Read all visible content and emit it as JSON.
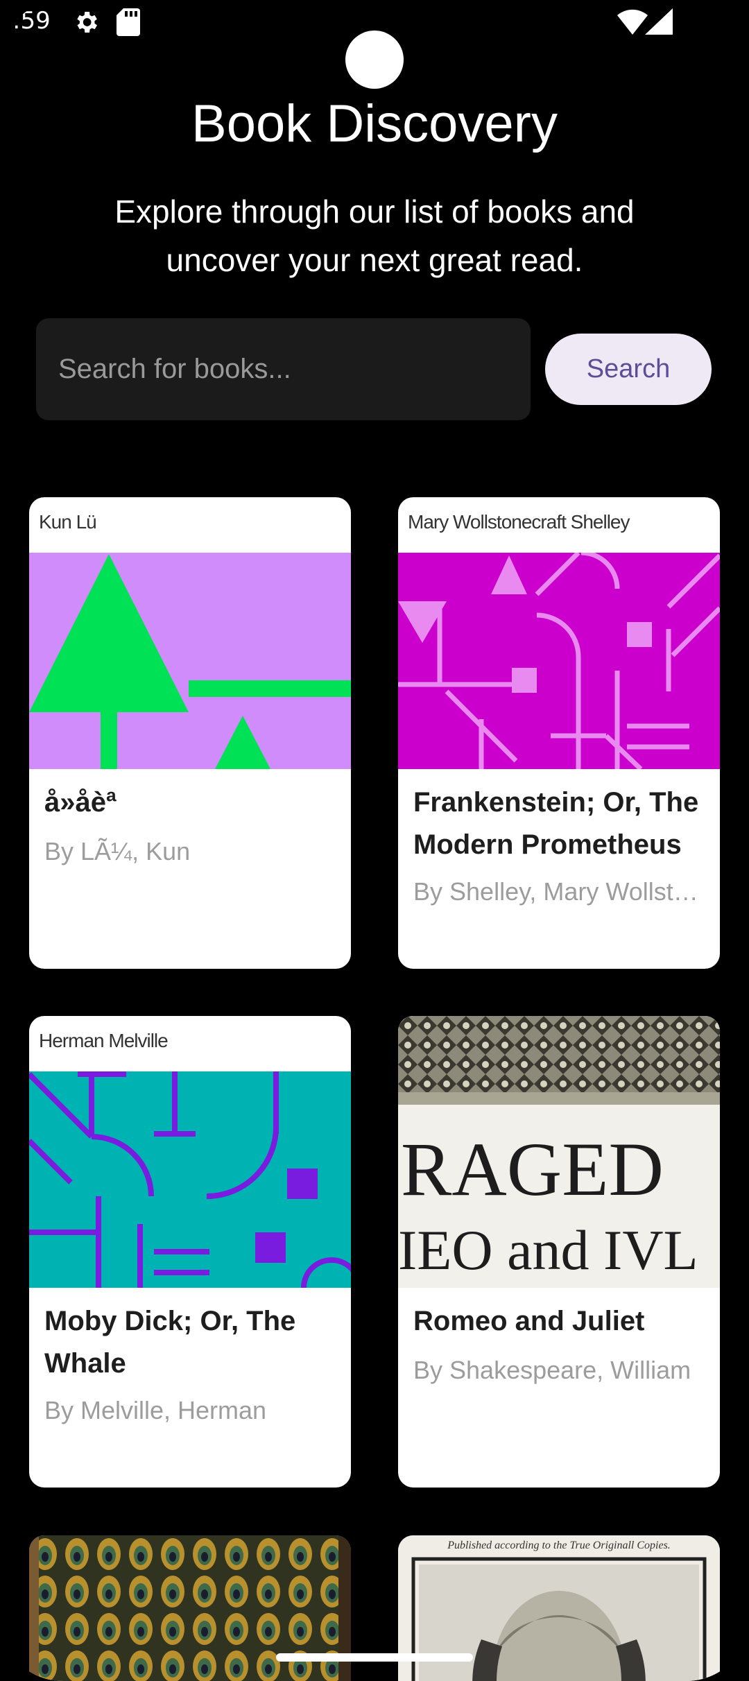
{
  "status": {
    "time": ":59"
  },
  "header": {
    "title": "Book Discovery",
    "subtitle": "Explore through our list of books and uncover your next great read."
  },
  "search": {
    "placeholder": "Search for books...",
    "button_label": "Search"
  },
  "books": [
    {
      "cover_author": "Kun Lü",
      "title": "å»åèª",
      "author": "By LÃ¼, Kun"
    },
    {
      "cover_author": "Mary Wollstonecraft Shelley",
      "title": "Frankenstein; Or, The Modern Prometheus",
      "author": "By Shelley, Mary Wollstonecraft"
    },
    {
      "cover_author": "Herman Melville",
      "title": "Moby Dick; Or, The Whale",
      "author": "By Melville, Herman"
    },
    {
      "cover_text_1": "RAGED",
      "cover_text_2": "IEO and IVL",
      "title": "Romeo and Juliet",
      "author": "By Shakespeare, William"
    },
    {
      "title": ""
    },
    {
      "cover_caption": "Published according to the True Originall Copies."
    }
  ],
  "colors": {
    "background": "#000000",
    "search_field": "#1b1b1b",
    "button_bg": "#efe9f6",
    "button_text": "#5b4d96",
    "card_bg": "#ffffff",
    "author_text": "#9c9c9c"
  }
}
